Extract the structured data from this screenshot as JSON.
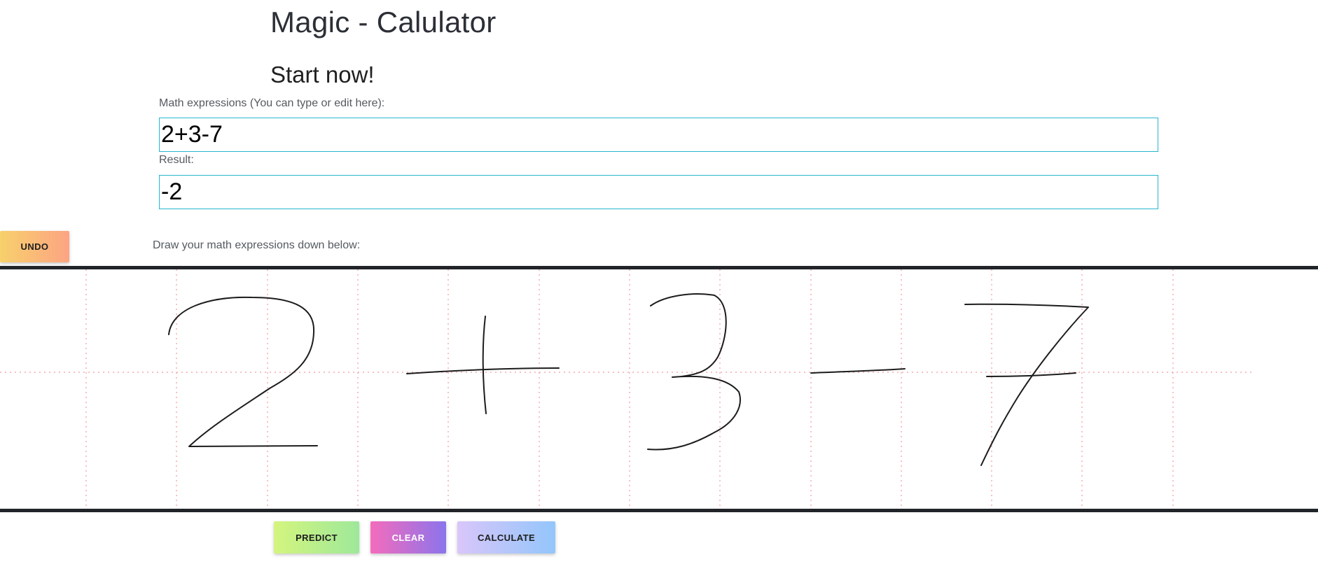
{
  "header": {
    "title": "Magic - Calulator",
    "subtitle": "Start now!"
  },
  "expression": {
    "label": "Math expressions (You can type or edit here):",
    "value": "2+3-7"
  },
  "result": {
    "label": "Result:",
    "value": "-2"
  },
  "drawing": {
    "undo_label": "UNDO",
    "instruction": "Draw your math expressions down below:",
    "ink_color": "#1c1c1c",
    "grid_color": "#f29a9a",
    "border_color": "#212529"
  },
  "actions": {
    "predict_label": "PREDICT",
    "clear_label": "CLEAR",
    "calculate_label": "CALCULATE"
  },
  "colors": {
    "field_border": "#27b6cd",
    "undo_gradient": [
      "#f8d06c",
      "#fca483"
    ],
    "predict_gradient": [
      "#d4f57e",
      "#9ee89a"
    ],
    "clear_gradient": [
      "#f46cbc",
      "#8b74ec"
    ],
    "calculate_gradient": [
      "#d9c6fa",
      "#93c6fb"
    ]
  }
}
